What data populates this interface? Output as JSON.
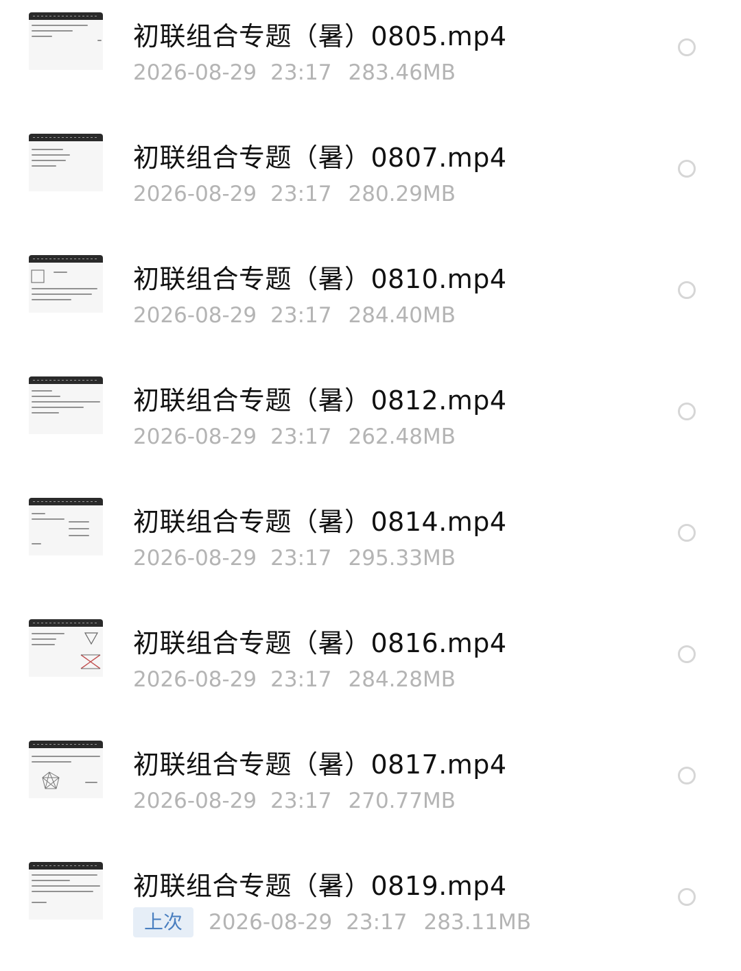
{
  "files": [
    {
      "name": "初联组合专题（暑）0805.mp4",
      "date": "2026-08-29",
      "time": "23:17",
      "size": "283.46MB",
      "badge": "",
      "thumbnail": "video-thumbnail-handwritten-notes"
    },
    {
      "name": "初联组合专题（暑）0807.mp4",
      "date": "2026-08-29",
      "time": "23:17",
      "size": "280.29MB",
      "badge": "",
      "thumbnail": "video-thumbnail-handwritten-notes"
    },
    {
      "name": "初联组合专题（暑）0810.mp4",
      "date": "2026-08-29",
      "time": "23:17",
      "size": "284.40MB",
      "badge": "",
      "thumbnail": "video-thumbnail-handwritten-notes"
    },
    {
      "name": "初联组合专题（暑）0812.mp4",
      "date": "2026-08-29",
      "time": "23:17",
      "size": "262.48MB",
      "badge": "",
      "thumbnail": "video-thumbnail-handwritten-notes"
    },
    {
      "name": "初联组合专题（暑）0814.mp4",
      "date": "2026-08-29",
      "time": "23:17",
      "size": "295.33MB",
      "badge": "",
      "thumbnail": "video-thumbnail-handwritten-notes"
    },
    {
      "name": "初联组合专题（暑）0816.mp4",
      "date": "2026-08-29",
      "time": "23:17",
      "size": "284.28MB",
      "badge": "",
      "thumbnail": "video-thumbnail-handwritten-notes"
    },
    {
      "name": "初联组合专题（暑）0817.mp4",
      "date": "2026-08-29",
      "time": "23:17",
      "size": "270.77MB",
      "badge": "",
      "thumbnail": "video-thumbnail-handwritten-notes"
    },
    {
      "name": "初联组合专题（暑）0819.mp4",
      "date": "2026-08-29",
      "time": "23:17",
      "size": "283.11MB",
      "badge": "上次",
      "thumbnail": "video-thumbnail-handwritten-notes"
    }
  ],
  "colors": {
    "title": "#111111",
    "meta": "#b4b4b4",
    "badge_bg": "#e6eef7",
    "badge_text": "#4a7fc0",
    "radio_border": "#d6d6d6"
  }
}
